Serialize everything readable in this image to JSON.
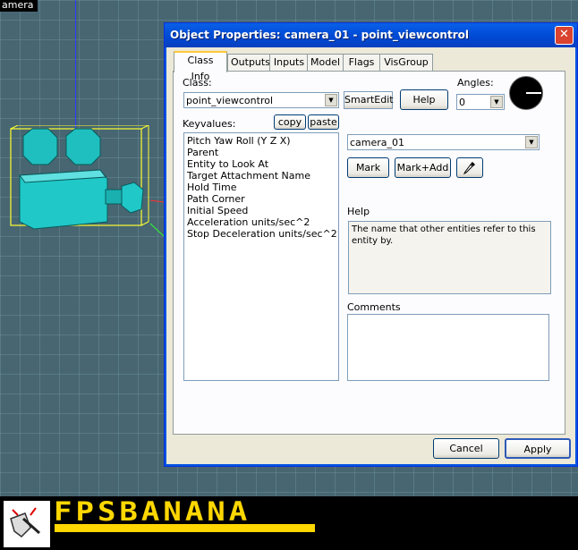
{
  "viewport": {
    "label": "amera"
  },
  "dialog": {
    "title": "Object Properties: camera_01 - point_viewcontrol",
    "close_glyph": "✕",
    "tabs": [
      {
        "label": "Class Info"
      },
      {
        "label": "Outputs"
      },
      {
        "label": "Inputs"
      },
      {
        "label": "Model"
      },
      {
        "label": "Flags"
      },
      {
        "label": "VisGroup"
      }
    ],
    "active_tab": "Class Info",
    "class_label": "Class:",
    "class_value": "point_viewcontrol",
    "smartedit_label": "SmartEdit",
    "help_button": "Help",
    "angles_label": "Angles:",
    "angles_value": "0",
    "keyvalues_label": "Keyvalues:",
    "copy_button": "copy",
    "paste_button": "paste",
    "keyvalues": [
      "Pitch Yaw Roll (Y Z X)",
      "Parent",
      "Entity to Look At",
      "Target Attachment Name",
      "Hold Time",
      "Path Corner",
      "Initial Speed",
      "Acceleration units/sec^2",
      "Stop Deceleration units/sec^2"
    ],
    "value_combo": "camera_01",
    "mark_button": "Mark",
    "mark_add_button": "Mark+Add",
    "help_label": "Help",
    "help_text": "The name that other entities refer to this entity by.",
    "comments_label": "Comments",
    "comments_value": "",
    "cancel_button": "Cancel",
    "apply_button": "Apply"
  },
  "banner": {
    "text": "FPSBANANA",
    "color": "#ffd700"
  }
}
